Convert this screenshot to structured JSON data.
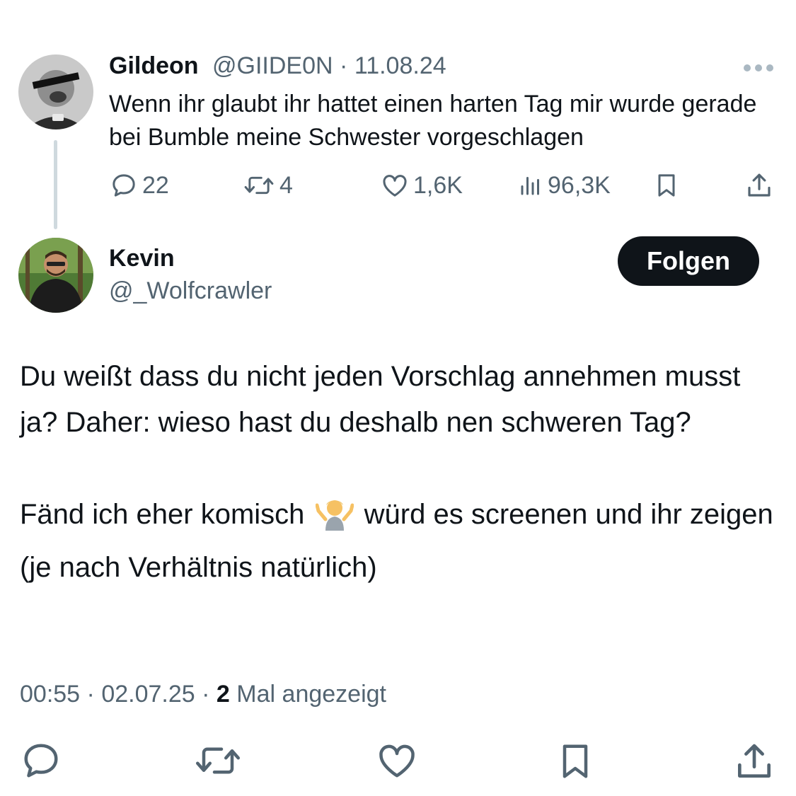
{
  "quoted_tweet": {
    "display_name": "Gildeon",
    "handle": "@GIIDE0N",
    "date": "11.08.24",
    "separator": "·",
    "text": "Wenn ihr glaubt ihr hattet einen harten Tag mir wurde gerade bei Bumble meine Schwester vorgeschlagen",
    "stats": {
      "replies": "22",
      "reposts": "4",
      "likes": "1,6K",
      "views": "96,3K"
    },
    "icons": [
      "reply-icon",
      "repost-icon",
      "like-icon",
      "views-icon",
      "bookmark-icon",
      "share-icon",
      "more-icon"
    ]
  },
  "reply_tweet": {
    "display_name": "Kevin",
    "handle": "@_Wolfcrawler",
    "follow_label": "Folgen",
    "paragraph_1": "Du weißt dass du nicht jeden Vorschlag annehmen musst ja? Daher: wieso hast du deshalb nen schweren Tag?",
    "paragraph_2_before_emoji": "Fänd ich eher komisch",
    "emoji": "person-shrugging-emoji",
    "paragraph_2_after_emoji": "würd es screenen und ihr zeigen (je nach Verhältnis natürlich)",
    "time": "00:55",
    "date": "02.07.25",
    "separator": "·",
    "view_count": "2",
    "view_label": "Mal angezeigt"
  },
  "actions": [
    "reply-icon",
    "repost-icon",
    "like-icon",
    "bookmark-icon",
    "share-icon"
  ],
  "colors": {
    "text": "#0f1419",
    "muted": "#536471",
    "thread_line": "#cfd9de",
    "follow_bg": "#0f1419",
    "follow_text": "#ffffff",
    "more_dots": "#aab8c2"
  }
}
